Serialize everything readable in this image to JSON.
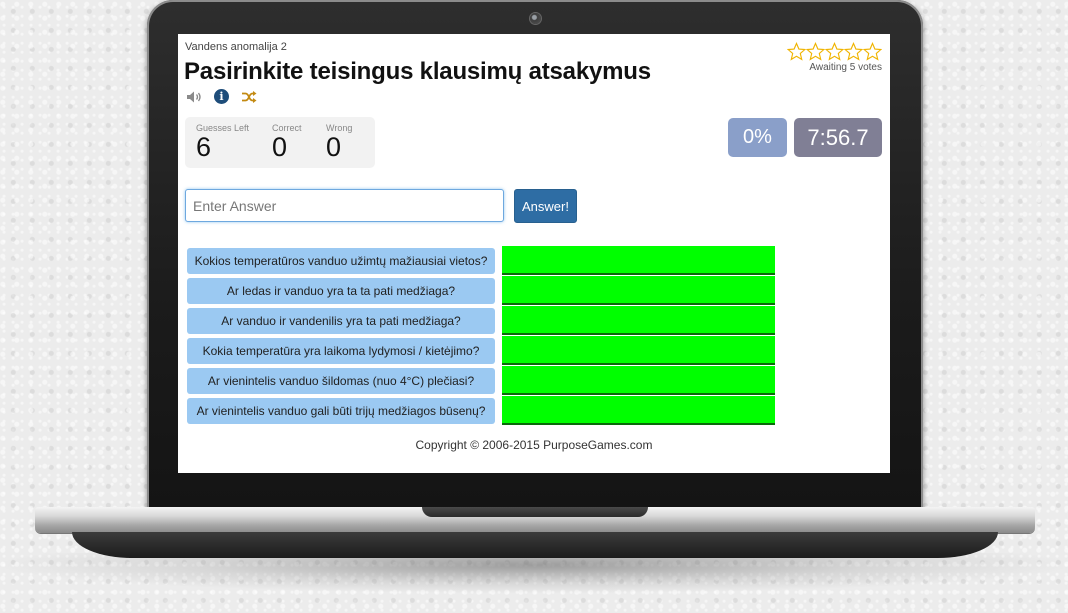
{
  "quiz": {
    "subtitle": "Vandens anomalija 2",
    "title": "Pasirinkite teisingus klausimų atsakymus"
  },
  "toolbar": {
    "icons": [
      "speaker-icon",
      "info-icon",
      "shuffle-icon"
    ],
    "info_glyph": "i"
  },
  "rating": {
    "stars_filled": 0,
    "stars_total": 5,
    "votes_text": "Awaiting 5 votes",
    "star_color": "#f0b400"
  },
  "stats": {
    "guesses_left_label": "Guesses Left",
    "guesses_left_value": "6",
    "correct_label": "Correct",
    "correct_value": "0",
    "wrong_label": "Wrong",
    "wrong_value": "0"
  },
  "progress": {
    "percent_text": "0%",
    "timer_text": "7:56.7",
    "percent_color": "#8a9fc9",
    "timer_color": "#807f95"
  },
  "answer_form": {
    "placeholder": "Enter Answer",
    "value": "",
    "button_label": "Answer!"
  },
  "questions": [
    {
      "text": "Kokios temperatūros vanduo užimtų mažiausiai vietos?",
      "answer": ""
    },
    {
      "text": "Ar ledas ir vanduo yra ta ta pati medžiaga?",
      "answer": ""
    },
    {
      "text": "Ar vanduo ir vandenilis yra ta pati medžiaga?",
      "answer": ""
    },
    {
      "text": "Kokia temperatūra yra laikoma lydymosi / kietėjimo?",
      "answer": ""
    },
    {
      "text": "Ar vienintelis vanduo šildomas (nuo 4°C) plečiasi?",
      "answer": ""
    },
    {
      "text": "Ar vienintelis vanduo gali būti trijų medžiagos būsenų?",
      "answer": ""
    }
  ],
  "colors": {
    "question_bg": "#9bc9f2",
    "answer_slot_bg": "#00ff00",
    "button_bg": "#2e6da4"
  },
  "footer": {
    "copyright": "Copyright © 2006-2015 PurposeGames.com"
  }
}
